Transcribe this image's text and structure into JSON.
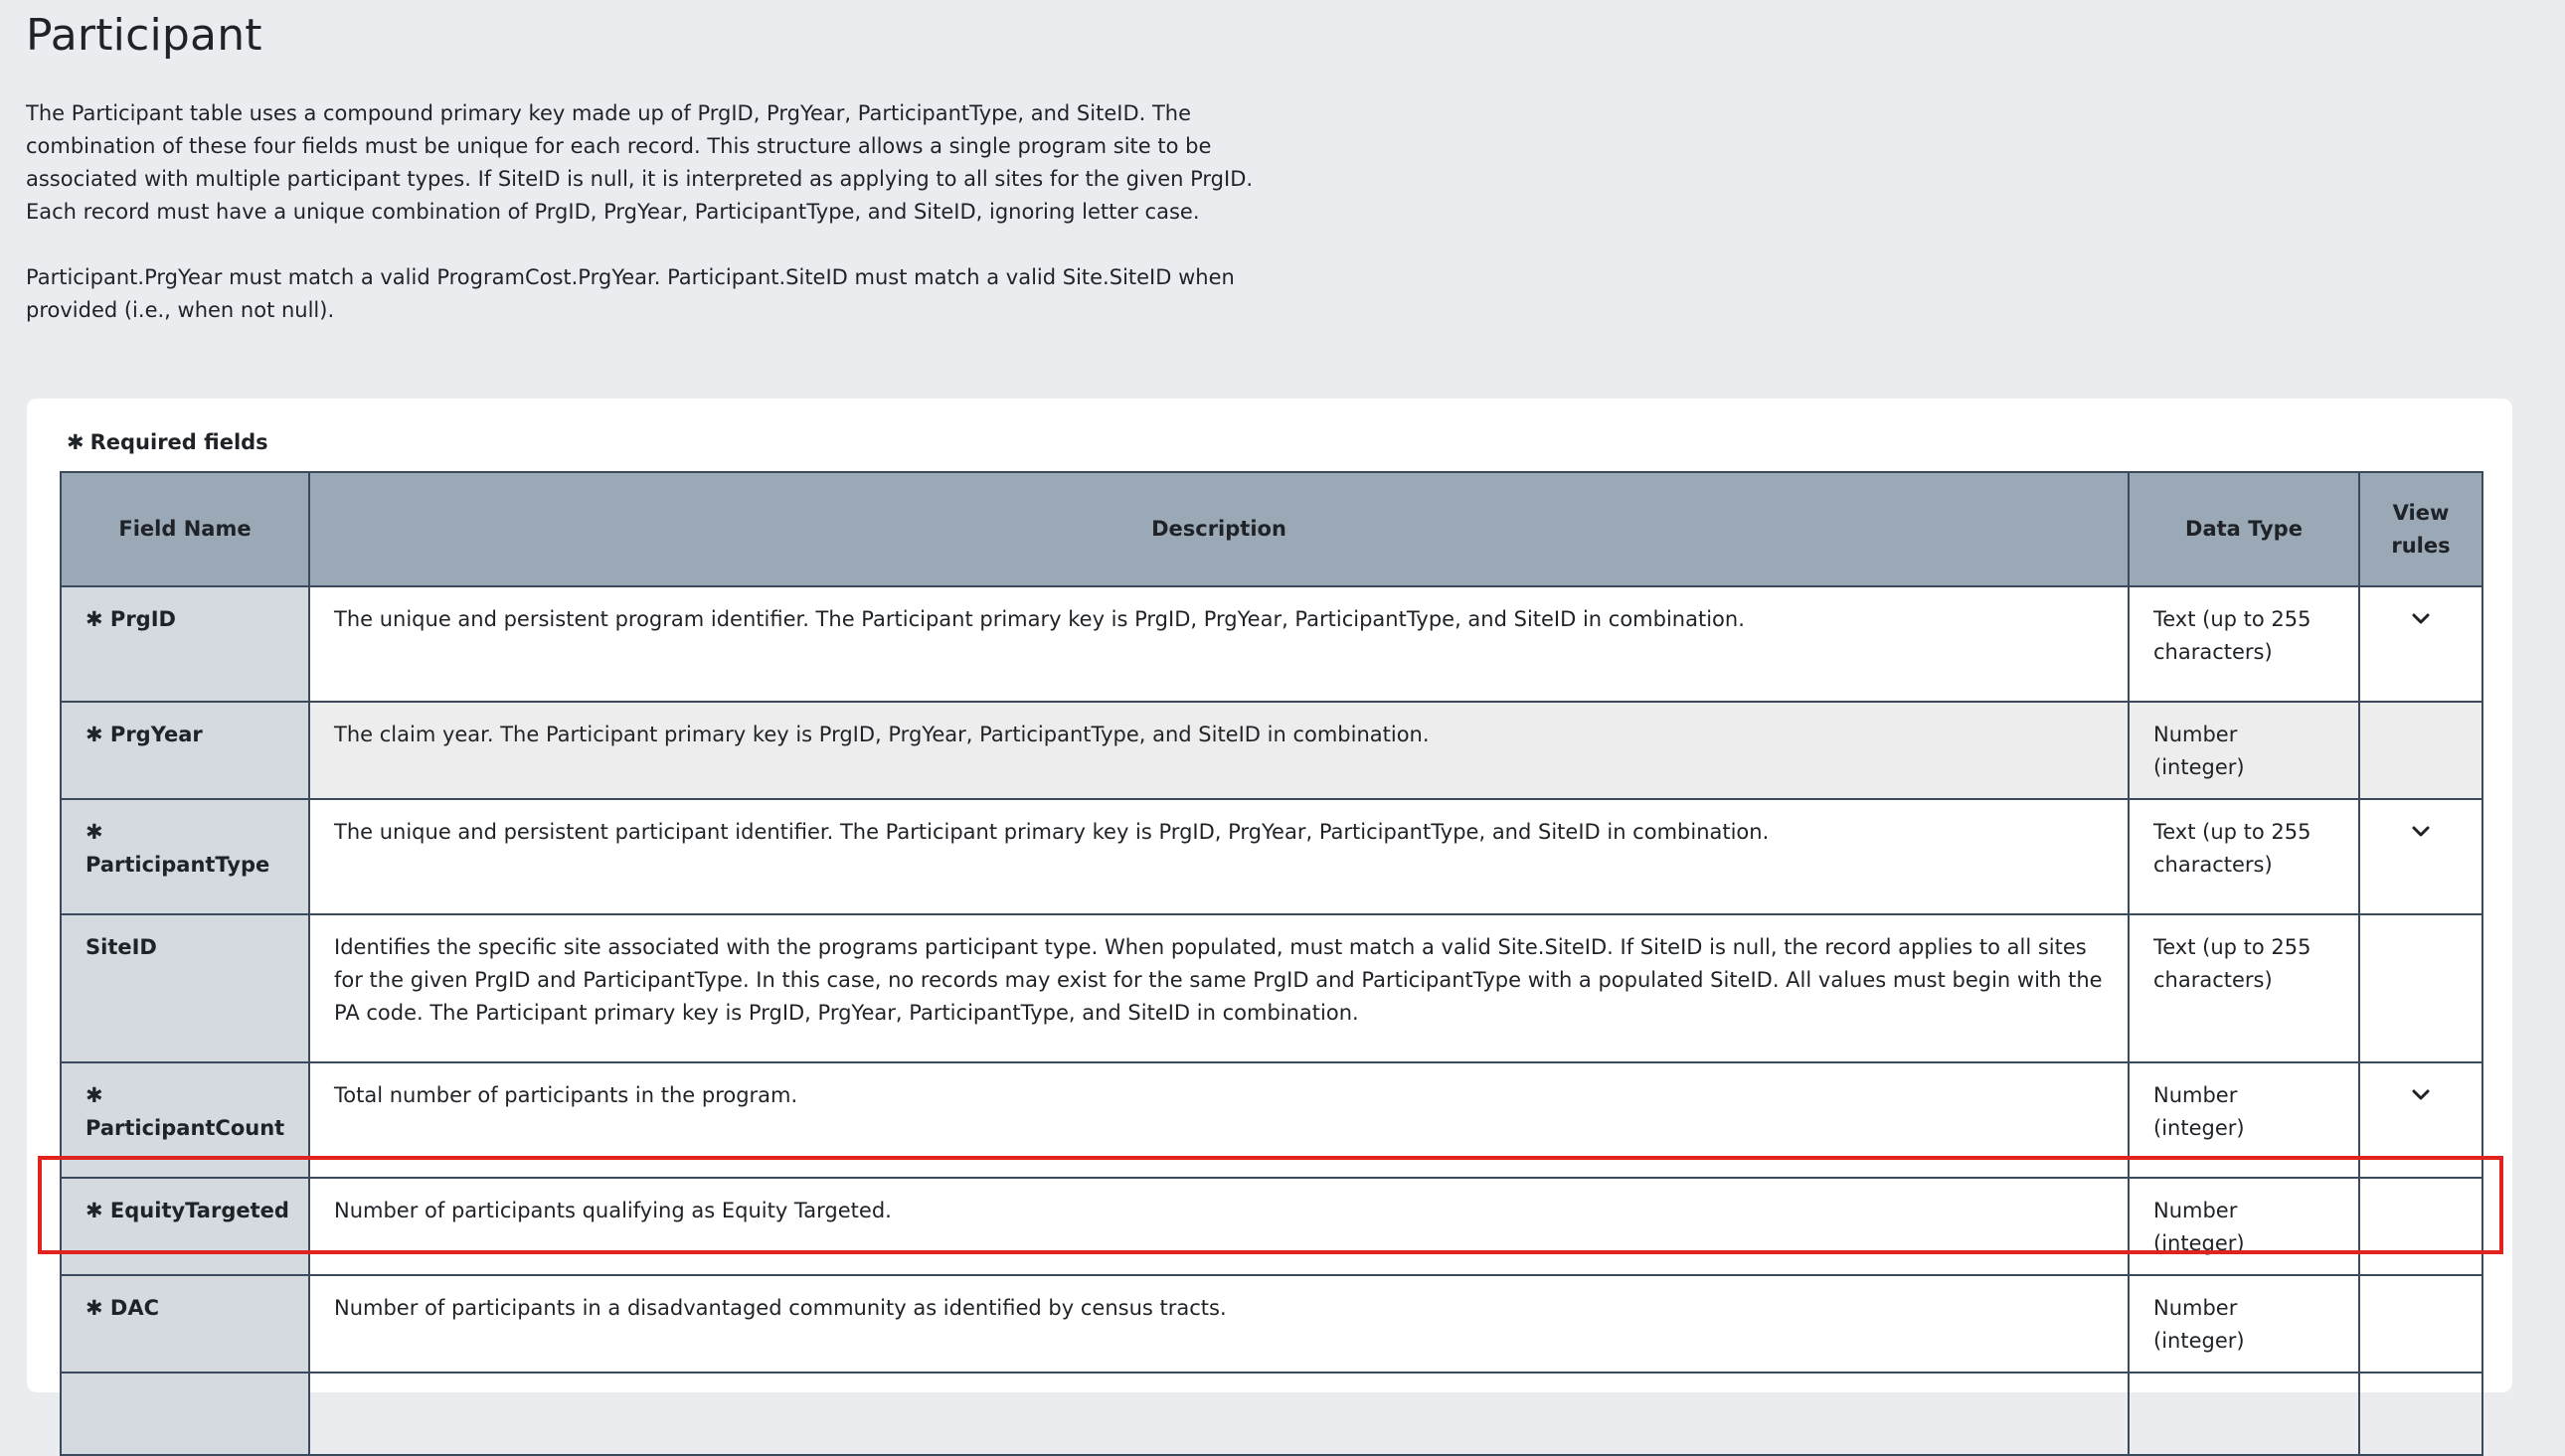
{
  "page": {
    "title": "Participant",
    "intro_p1": "The Participant table uses a compound primary key made up of PrgID, PrgYear, ParticipantType, and SiteID. The combination of these four fields must be unique for each record. This structure allows a single program site to be associated with multiple participant types. If SiteID is null, it is interpreted as applying to all sites for the given PrgID. Each record must have a unique combination of PrgID, PrgYear, ParticipantType, and SiteID, ignoring letter case.",
    "intro_p2": "Participant.PrgYear must match a valid ProgramCost.PrgYear. Participant.SiteID must match a valid Site.SiteID when provided (i.e., when not null)."
  },
  "legend": {
    "required_symbol": "✱",
    "required_label": "Required fields"
  },
  "table": {
    "headers": {
      "field_name": "Field Name",
      "description": "Description",
      "data_type": "Data Type",
      "view_rules": "View rules"
    },
    "rows": [
      {
        "required": "✱",
        "name": "PrgID",
        "description": "The unique and persistent program identifier. The Participant primary key is PrgID, PrgYear, ParticipantType, and SiteID in combination.",
        "data_type": "Text (up to 255 characters)"
      },
      {
        "required": "✱",
        "name": "PrgYear",
        "description": "The claim year. The Participant primary key is PrgID, PrgYear, ParticipantType, and SiteID in combination.",
        "data_type": "Number (integer)"
      },
      {
        "required": "✱",
        "name": "ParticipantType",
        "description": "The unique and persistent participant identifier. The Participant primary key is PrgID, PrgYear, ParticipantType, and SiteID in combination.",
        "data_type": "Text (up to 255 characters)"
      },
      {
        "required": "",
        "name": "SiteID",
        "description": "Identifies the specific site associated with the programs participant type. When populated, must match a valid Site.SiteID. If SiteID is null, the record applies to all sites for the given PrgID and ParticipantType. In this case, no records may exist for the same PrgID and ParticipantType with a populated SiteID. All values must begin with the PA code. The Participant primary key is PrgID, PrgYear, ParticipantType, and SiteID in combination.",
        "data_type": "Text (up to 255 characters)"
      },
      {
        "required": "✱",
        "name": "ParticipantCount",
        "description": "Total number of participants in the program.",
        "data_type": "Number (integer)"
      },
      {
        "required": "✱",
        "name": "EquityTargeted",
        "description": "Number of participants qualifying as Equity Targeted.",
        "data_type": "Number (integer)"
      },
      {
        "required": "✱",
        "name": "DAC",
        "description": "Number of participants in a disadvantaged community as identified by census tracts.",
        "data_type": "Number (integer)"
      }
    ]
  },
  "colors": {
    "header_bg": "#9aa9b5",
    "field_cell_bg": "#d5dae0",
    "highlight": "#e0231f",
    "page_bg": "#ebecf0"
  },
  "icons": {
    "rules_toggle": "chevron-down-icon"
  }
}
